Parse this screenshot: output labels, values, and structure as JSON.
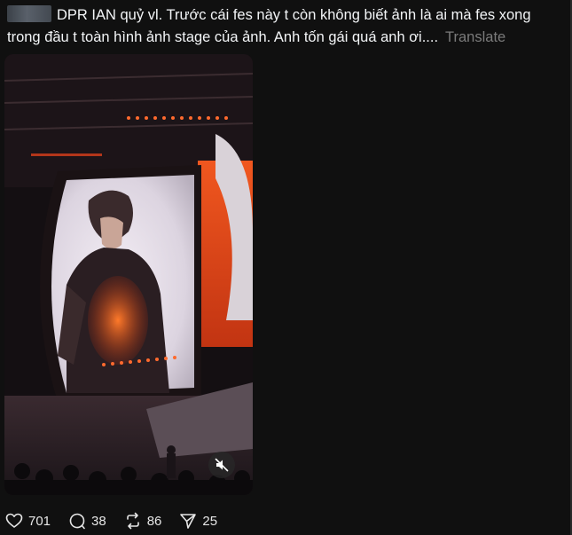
{
  "post": {
    "text": "DPR IAN quỷ vl. Trước cái fes này t còn không biết ảnh là ai mà fes xong trong đầu t toàn hình ảnh stage của ảnh. Anh tốn gái quá anh ơi....",
    "translate_label": "Translate"
  },
  "media": {
    "type": "video",
    "muted": true,
    "icon": "speaker-muted-icon"
  },
  "actions": {
    "likes": "701",
    "comments": "38",
    "reposts": "86",
    "shares": "25"
  },
  "colors": {
    "background": "#101010",
    "text": "#f3f5f7",
    "muted_text": "#7b7b7b",
    "stage_accent": "#e24a1e"
  }
}
